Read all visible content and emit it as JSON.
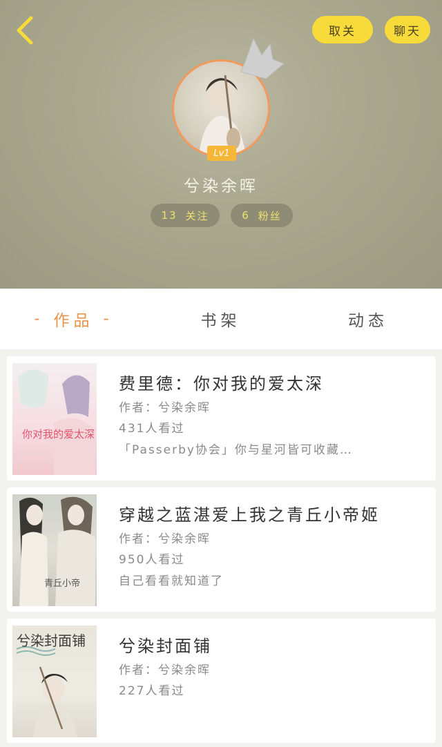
{
  "header": {
    "unfollow_label": "取关",
    "chat_label": "聊天",
    "level": "Lv1",
    "username": "兮染余晖",
    "following_count": "13",
    "following_label": "关注",
    "fans_count": "6",
    "fans_label": "粉丝"
  },
  "tabs": {
    "works": "作品",
    "dash": "-",
    "shelf": "书架",
    "feed": "动态"
  },
  "books": [
    {
      "title": "费里德：你对我的爱太深",
      "author": "作者：兮染余晖",
      "views": "431人看过",
      "desc": "「Passerby协会」你与星河皆可收藏…",
      "cover_text": "你对我的爱太深"
    },
    {
      "title": "穿越之蓝湛爱上我之青丘小帝姬",
      "author": "作者：兮染余晖",
      "views": "950人看过",
      "desc": "自己看看就知道了",
      "cover_text": "青丘小帝"
    },
    {
      "title": "兮染封面铺",
      "author": "作者：兮染余晖",
      "views": "227人看过",
      "cover_text": "兮染封面铺"
    }
  ],
  "colors": {
    "accent_yellow": "#f7db3a",
    "tab_active": "#e8944c",
    "avatar_ring": "#f19a5d",
    "level_badge": "#f6b637"
  }
}
